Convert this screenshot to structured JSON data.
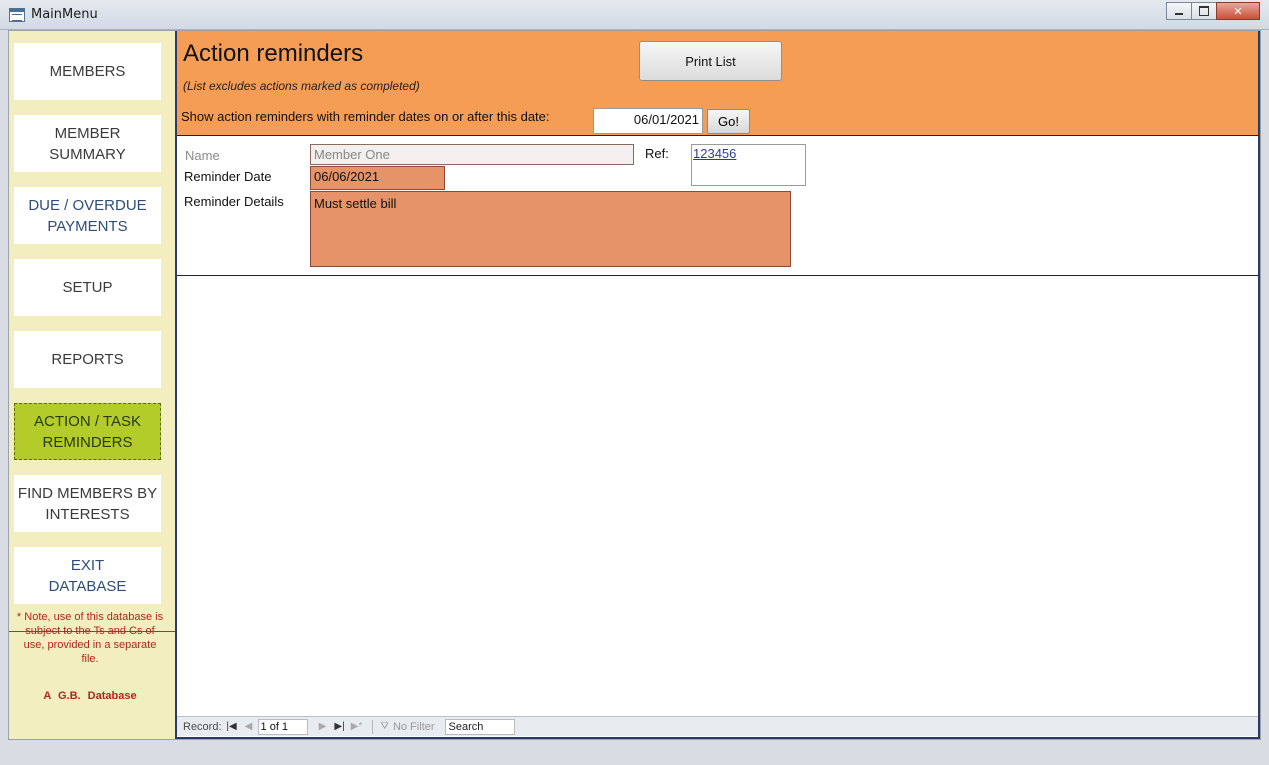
{
  "window": {
    "title": "MainMenu"
  },
  "sidebar": {
    "items": [
      {
        "label": "MEMBERS"
      },
      {
        "label": "MEMBER\nSUMMARY"
      },
      {
        "label": "DUE / OVERDUE\nPAYMENTS"
      },
      {
        "label": "SETUP"
      },
      {
        "label": "REPORTS"
      },
      {
        "label": "ACTION / TASK\nREMINDERS"
      },
      {
        "label": "FIND MEMBERS BY\nINTERESTS"
      },
      {
        "label": "EXIT\nDATABASE"
      }
    ],
    "note": "* Note, use of this database is subject to the Ts and Cs of use, provided in a separate file.",
    "brand": "A G.B. Database"
  },
  "header": {
    "title": "Action reminders",
    "subtitle": "(List excludes actions marked as completed)",
    "print_label": "Print List",
    "date_label": "Show action reminders with reminder dates on or after this date:",
    "date_value": "06/01/2021",
    "go_label": "Go!"
  },
  "record": {
    "name_label": "Name",
    "name_value": "Member One",
    "ref_label": "Ref:",
    "ref_value": "123456",
    "reminder_date_label": "Reminder Date",
    "reminder_date_value": "06/06/2021",
    "reminder_details_label": "Reminder Details",
    "reminder_details_value": "Must settle bill"
  },
  "navbar": {
    "record_label": "Record:",
    "position": "1 of 1",
    "filter_label": "No Filter",
    "search_label": "Search"
  },
  "colors": {
    "header_bg": "#f59d55",
    "sidebar_bg": "#f2eec0",
    "active_button": "#b3cc29",
    "field_highlight": "#e6936a",
    "note_text": "#b3261e"
  }
}
